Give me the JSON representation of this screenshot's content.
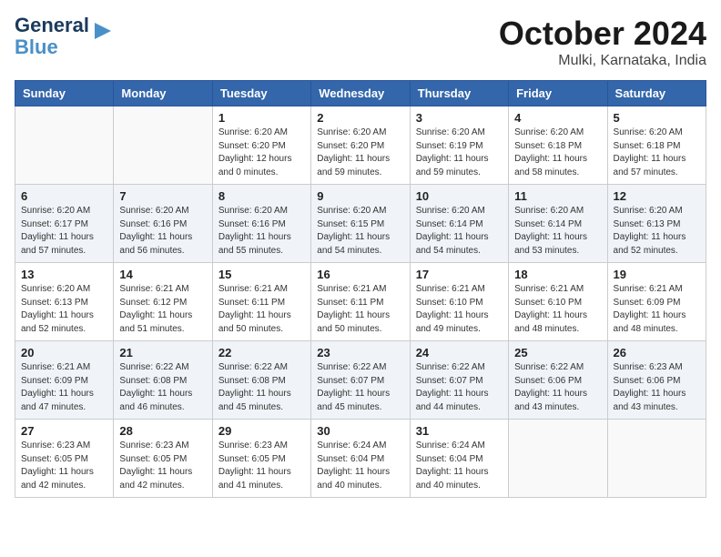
{
  "header": {
    "logo_line1": "General",
    "logo_line2": "Blue",
    "month": "October 2024",
    "location": "Mulki, Karnataka, India"
  },
  "weekdays": [
    "Sunday",
    "Monday",
    "Tuesday",
    "Wednesday",
    "Thursday",
    "Friday",
    "Saturday"
  ],
  "weeks": [
    [
      {
        "day": "",
        "info": ""
      },
      {
        "day": "",
        "info": ""
      },
      {
        "day": "1",
        "info": "Sunrise: 6:20 AM\nSunset: 6:20 PM\nDaylight: 12 hours\nand 0 minutes."
      },
      {
        "day": "2",
        "info": "Sunrise: 6:20 AM\nSunset: 6:20 PM\nDaylight: 11 hours\nand 59 minutes."
      },
      {
        "day": "3",
        "info": "Sunrise: 6:20 AM\nSunset: 6:19 PM\nDaylight: 11 hours\nand 59 minutes."
      },
      {
        "day": "4",
        "info": "Sunrise: 6:20 AM\nSunset: 6:18 PM\nDaylight: 11 hours\nand 58 minutes."
      },
      {
        "day": "5",
        "info": "Sunrise: 6:20 AM\nSunset: 6:18 PM\nDaylight: 11 hours\nand 57 minutes."
      }
    ],
    [
      {
        "day": "6",
        "info": "Sunrise: 6:20 AM\nSunset: 6:17 PM\nDaylight: 11 hours\nand 57 minutes."
      },
      {
        "day": "7",
        "info": "Sunrise: 6:20 AM\nSunset: 6:16 PM\nDaylight: 11 hours\nand 56 minutes."
      },
      {
        "day": "8",
        "info": "Sunrise: 6:20 AM\nSunset: 6:16 PM\nDaylight: 11 hours\nand 55 minutes."
      },
      {
        "day": "9",
        "info": "Sunrise: 6:20 AM\nSunset: 6:15 PM\nDaylight: 11 hours\nand 54 minutes."
      },
      {
        "day": "10",
        "info": "Sunrise: 6:20 AM\nSunset: 6:14 PM\nDaylight: 11 hours\nand 54 minutes."
      },
      {
        "day": "11",
        "info": "Sunrise: 6:20 AM\nSunset: 6:14 PM\nDaylight: 11 hours\nand 53 minutes."
      },
      {
        "day": "12",
        "info": "Sunrise: 6:20 AM\nSunset: 6:13 PM\nDaylight: 11 hours\nand 52 minutes."
      }
    ],
    [
      {
        "day": "13",
        "info": "Sunrise: 6:20 AM\nSunset: 6:13 PM\nDaylight: 11 hours\nand 52 minutes."
      },
      {
        "day": "14",
        "info": "Sunrise: 6:21 AM\nSunset: 6:12 PM\nDaylight: 11 hours\nand 51 minutes."
      },
      {
        "day": "15",
        "info": "Sunrise: 6:21 AM\nSunset: 6:11 PM\nDaylight: 11 hours\nand 50 minutes."
      },
      {
        "day": "16",
        "info": "Sunrise: 6:21 AM\nSunset: 6:11 PM\nDaylight: 11 hours\nand 50 minutes."
      },
      {
        "day": "17",
        "info": "Sunrise: 6:21 AM\nSunset: 6:10 PM\nDaylight: 11 hours\nand 49 minutes."
      },
      {
        "day": "18",
        "info": "Sunrise: 6:21 AM\nSunset: 6:10 PM\nDaylight: 11 hours\nand 48 minutes."
      },
      {
        "day": "19",
        "info": "Sunrise: 6:21 AM\nSunset: 6:09 PM\nDaylight: 11 hours\nand 48 minutes."
      }
    ],
    [
      {
        "day": "20",
        "info": "Sunrise: 6:21 AM\nSunset: 6:09 PM\nDaylight: 11 hours\nand 47 minutes."
      },
      {
        "day": "21",
        "info": "Sunrise: 6:22 AM\nSunset: 6:08 PM\nDaylight: 11 hours\nand 46 minutes."
      },
      {
        "day": "22",
        "info": "Sunrise: 6:22 AM\nSunset: 6:08 PM\nDaylight: 11 hours\nand 45 minutes."
      },
      {
        "day": "23",
        "info": "Sunrise: 6:22 AM\nSunset: 6:07 PM\nDaylight: 11 hours\nand 45 minutes."
      },
      {
        "day": "24",
        "info": "Sunrise: 6:22 AM\nSunset: 6:07 PM\nDaylight: 11 hours\nand 44 minutes."
      },
      {
        "day": "25",
        "info": "Sunrise: 6:22 AM\nSunset: 6:06 PM\nDaylight: 11 hours\nand 43 minutes."
      },
      {
        "day": "26",
        "info": "Sunrise: 6:23 AM\nSunset: 6:06 PM\nDaylight: 11 hours\nand 43 minutes."
      }
    ],
    [
      {
        "day": "27",
        "info": "Sunrise: 6:23 AM\nSunset: 6:05 PM\nDaylight: 11 hours\nand 42 minutes."
      },
      {
        "day": "28",
        "info": "Sunrise: 6:23 AM\nSunset: 6:05 PM\nDaylight: 11 hours\nand 42 minutes."
      },
      {
        "day": "29",
        "info": "Sunrise: 6:23 AM\nSunset: 6:05 PM\nDaylight: 11 hours\nand 41 minutes."
      },
      {
        "day": "30",
        "info": "Sunrise: 6:24 AM\nSunset: 6:04 PM\nDaylight: 11 hours\nand 40 minutes."
      },
      {
        "day": "31",
        "info": "Sunrise: 6:24 AM\nSunset: 6:04 PM\nDaylight: 11 hours\nand 40 minutes."
      },
      {
        "day": "",
        "info": ""
      },
      {
        "day": "",
        "info": ""
      }
    ]
  ]
}
